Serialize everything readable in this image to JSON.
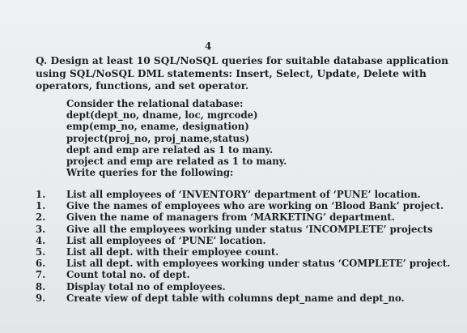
{
  "page_number": "4",
  "question": "Q. Design at least 10 SQL/NoSQL queries for suitable database application using SQL/NoSQL DML statements: Insert, Select, Update, Delete with operators, functions, and set operator.",
  "schema_lines": [
    "Consider the relational database:",
    "dept(dept_no, dname, loc, mgrcode)",
    "emp(emp_no, ename, designation)",
    "project(proj_no, proj_name,status)",
    "dept and emp are related as 1 to many.",
    "project and emp are related as 1 to many.",
    "Write queries for the following:"
  ],
  "items": [
    {
      "num": "1.",
      "text": "List all employees of ‘INVENTORY’ department of ‘PUNE’ location."
    },
    {
      "num": "1.",
      "text": "Give the names of employees who are working on ‘Blood Bank’ project."
    },
    {
      "num": "2.",
      "text": "Given the name of managers from ‘MARKETING’ department."
    },
    {
      "num": "3.",
      "text": "Give all the employees working under status ‘INCOMPLETE’ projects"
    },
    {
      "num": "4.",
      "text": "List all employees of ‘PUNE’ location."
    },
    {
      "num": "5.",
      "text": "List all dept. with their employee count."
    },
    {
      "num": "6.",
      "text": "List all dept. with employees working under status ‘COMPLETE’ project."
    },
    {
      "num": "7.",
      "text": "Count total no. of dept."
    },
    {
      "num": "8.",
      "text": "Display total no of employees."
    },
    {
      "num": "9.",
      "text": "Create view of dept table with columns dept_name and dept_no."
    }
  ]
}
